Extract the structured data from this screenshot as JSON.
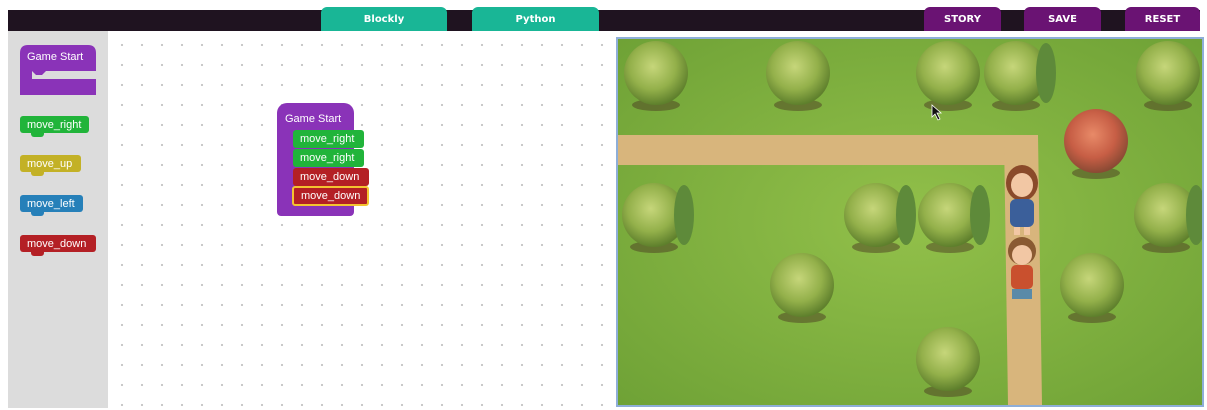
{
  "header": {
    "tabs": [
      {
        "label": "Blockly"
      },
      {
        "label": "Python"
      }
    ],
    "actions": [
      {
        "label": "STORY"
      },
      {
        "label": "SAVE"
      },
      {
        "label": "RESET"
      }
    ]
  },
  "toolbox": {
    "event_block": "Game Start",
    "blocks": [
      {
        "label": "move_right",
        "color": "#21b43a"
      },
      {
        "label": "move_up",
        "color": "#c3b126"
      },
      {
        "label": "move_left",
        "color": "#2680b9"
      },
      {
        "label": "move_down",
        "color": "#b42025"
      }
    ]
  },
  "workspace": {
    "program": {
      "event": "Game Start",
      "statements": [
        {
          "label": "move_right",
          "color": "#21b43a"
        },
        {
          "label": "move_right",
          "color": "#21b43a"
        },
        {
          "label": "move_down",
          "color": "#b42025"
        },
        {
          "label": "move_down",
          "color": "#b42025",
          "selected": true
        }
      ]
    }
  },
  "colors": {
    "header": "#1f1320",
    "tab": "#19b696",
    "action": "#6a1373",
    "event": "#8a33b8",
    "grass": "#7fb23d",
    "path": "#d8b57c"
  }
}
